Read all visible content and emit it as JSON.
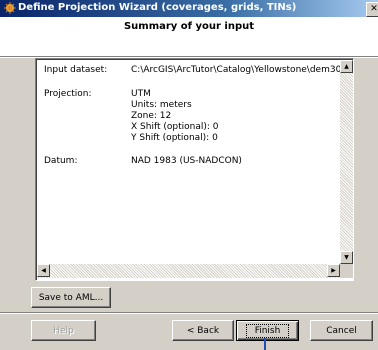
{
  "window": {
    "title": "Define Projection Wizard (coverages, grids, TINs)",
    "close_glyph": "✕"
  },
  "header": {
    "title": "Summary of your input"
  },
  "summary": {
    "rows": [
      {
        "label": "Input dataset:",
        "value": "C:\\ArcGIS\\ArcTutor\\Catalog\\Yellowstone\\dem30"
      },
      {
        "label": "Projection:",
        "value": "UTM"
      },
      {
        "label": "",
        "value": "Units:     meters"
      },
      {
        "label": "",
        "value": "Zone:     12"
      },
      {
        "label": "",
        "value": "X Shift (optional):   0"
      },
      {
        "label": "",
        "value": "Y Shift (optional):   0"
      },
      {
        "label": "Datum:",
        "value": "NAD 1983 (US-NADCON)"
      }
    ]
  },
  "scroll": {
    "up": "▲",
    "down": "▼",
    "left": "◀",
    "right": "▶"
  },
  "buttons": {
    "save_aml": "Save to AML...",
    "help": "Help",
    "back": "< Back",
    "finish": "Finish",
    "cancel": "Cancel"
  },
  "icons": {
    "title": "wizard-icon"
  }
}
